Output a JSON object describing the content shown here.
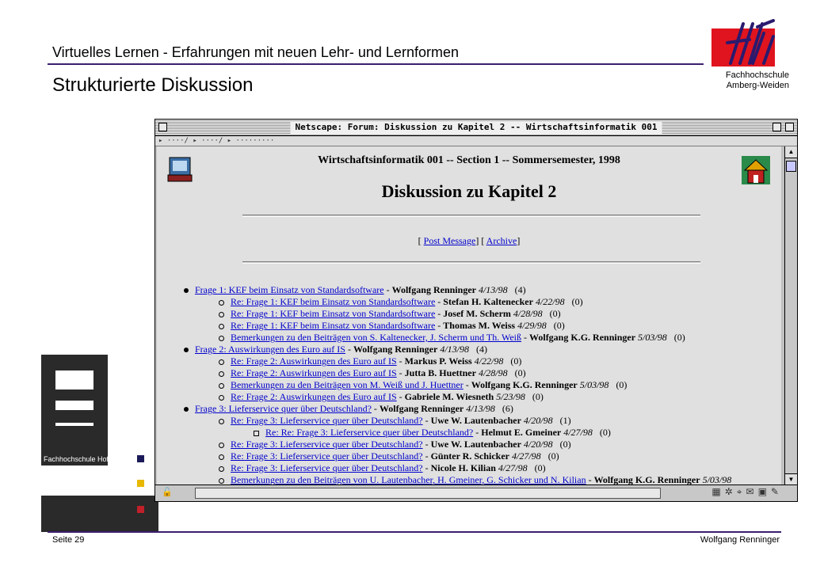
{
  "slide": {
    "title_line1": "Virtuelles Lernen - Erfahrungen mit neuen Lehr- und Lernformen",
    "title_line2": "Strukturierte Diskussion",
    "institution_line1": "Fachhochschule",
    "institution_line2": "Amberg-Weiden",
    "left_logo_label": "Fachhochschule Hof",
    "footer_left": "Seite 29",
    "footer_right": "Wolfgang Renninger"
  },
  "window": {
    "title": "Netscape: Forum: Diskussion zu Kapitel 2 -- Wirtschaftsinformatik 001",
    "course_line": "Wirtschaftsinformatik 001 -- Section 1 -- Sommersemester, 1998",
    "heading": "Diskussion zu Kapitel 2",
    "link_post": "Post Message",
    "link_archive": "Archive",
    "posts": [
      {
        "level": 0,
        "title": "Frage 1: KEF beim Einsatz von Standardsoftware",
        "author": "Wolfgang Renninger",
        "date": "4/13/98",
        "count": "(4)"
      },
      {
        "level": 1,
        "title": "Re: Frage 1: KEF beim Einsatz von Standardsoftware",
        "author": "Stefan H. Kaltenecker",
        "date": "4/22/98",
        "count": "(0)"
      },
      {
        "level": 1,
        "title": "Re: Frage 1: KEF beim Einsatz von Standardsoftware",
        "author": "Josef M. Scherm",
        "date": "4/28/98",
        "count": "(0)"
      },
      {
        "level": 1,
        "title": "Re: Frage 1: KEF beim Einsatz von Standardsoftware",
        "author": "Thomas M. Weiss",
        "date": "4/29/98",
        "count": "(0)"
      },
      {
        "level": 1,
        "title": "Bemerkungen zu den Beiträgen von S. Kaltenecker, J. Scherm und Th. Weiß",
        "author": "Wolfgang K.G. Renninger",
        "date": "5/03/98",
        "count": "(0)"
      },
      {
        "level": 0,
        "title": "Frage 2: Auswirkungen des Euro auf IS",
        "author": "Wolfgang Renninger",
        "date": "4/13/98",
        "count": "(4)"
      },
      {
        "level": 1,
        "title": "Re: Frage 2: Auswirkungen des Euro auf IS",
        "author": "Markus P. Weiss",
        "date": "4/22/98",
        "count": "(0)"
      },
      {
        "level": 1,
        "title": "Re: Frage 2: Auswirkungen des Euro auf IS",
        "author": "Jutta B. Huettner",
        "date": "4/28/98",
        "count": "(0)"
      },
      {
        "level": 1,
        "title": "Bemerkungen zu den Beiträgen von M. Weiß und J. Huettner",
        "author": "Wolfgang K.G. Renninger",
        "date": "5/03/98",
        "count": "(0)"
      },
      {
        "level": 1,
        "title": "Re: Frage 2: Auswirkungen des Euro auf IS",
        "author": "Gabriele M. Wiesneth",
        "date": "5/23/98",
        "count": "(0)"
      },
      {
        "level": 0,
        "title": "Frage 3: Lieferservice quer über Deutschland?",
        "author": "Wolfgang Renninger",
        "date": "4/13/98",
        "count": "(6)"
      },
      {
        "level": 1,
        "title": "Re: Frage 3: Lieferservice quer über Deutschland?",
        "author": "Uwe W. Lautenbacher",
        "date": "4/20/98",
        "count": "(1)"
      },
      {
        "level": 2,
        "title": "Re: Re: Frage 3: Lieferservice quer über Deutschland?",
        "author": "Helmut E. Gmeiner",
        "date": "4/27/98",
        "count": "(0)"
      },
      {
        "level": 1,
        "title": "Re: Frage 3: Lieferservice quer über Deutschland?",
        "author": "Uwe W. Lautenbacher",
        "date": "4/20/98",
        "count": "(0)"
      },
      {
        "level": 1,
        "title": "Re: Frage 3: Lieferservice quer über Deutschland?",
        "author": "Günter R. Schicker",
        "date": "4/27/98",
        "count": "(0)"
      },
      {
        "level": 1,
        "title": "Re: Frage 3: Lieferservice quer über Deutschland?",
        "author": "Nicole H. Kilian",
        "date": "4/27/98",
        "count": "(0)"
      },
      {
        "level": 1,
        "title": "Bemerkungen zu den Beiträgen von U. Lautenbacher, H. Gmeiner, G. Schicker und N. Kilian",
        "author": "Wolfgang K.G. Renninger",
        "date": "5/03/98",
        "count": ""
      }
    ]
  },
  "colors": {
    "accent_rule": "#3a1f6e",
    "logo_red": "#e0141e",
    "link": "#0000cc",
    "square_navy": "#1a1a5a",
    "square_yellow": "#e8b800",
    "square_red": "#c0202a"
  }
}
